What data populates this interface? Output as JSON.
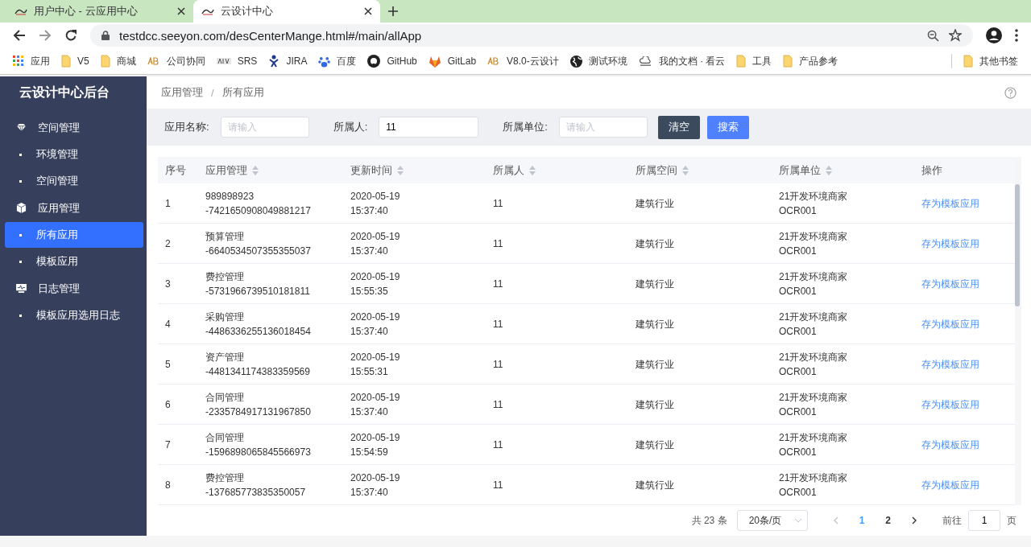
{
  "browser": {
    "tabs": [
      {
        "title": "用户中心 - 云应用中心",
        "selected": false
      },
      {
        "title": "云设计中心",
        "selected": true
      }
    ],
    "url": "testdcc.seeyon.com/desCenterMange.html#/main/allApp",
    "bookmarks": [
      {
        "label": "应用",
        "kind": "apps"
      },
      {
        "label": "V5",
        "kind": "folder"
      },
      {
        "label": "商城",
        "kind": "folder"
      },
      {
        "label": "公司协同",
        "kind": "ab"
      },
      {
        "label": "SRS",
        "kind": "abvs"
      },
      {
        "label": "JIRA",
        "kind": "jira"
      },
      {
        "label": "百度",
        "kind": "paw"
      },
      {
        "label": "GitHub",
        "kind": "github"
      },
      {
        "label": "GitLab",
        "kind": "gitlab"
      },
      {
        "label": "V8.0-云设计",
        "kind": "ab"
      },
      {
        "label": "测试环境",
        "kind": "globe"
      },
      {
        "label": "我的文档 · 看云",
        "kind": "cloud"
      },
      {
        "label": "工具",
        "kind": "folder"
      },
      {
        "label": "产品参考",
        "kind": "folder"
      }
    ],
    "other_bookmarks": "其他书签"
  },
  "sidebar": {
    "title": "云设计中心后台",
    "groups": [
      {
        "label": "空间管理",
        "children": [
          {
            "label": "环境管理",
            "selected": false
          },
          {
            "label": "空间管理",
            "selected": false
          }
        ]
      },
      {
        "label": "应用管理",
        "children": [
          {
            "label": "所有应用",
            "selected": true
          },
          {
            "label": "模板应用",
            "selected": false
          }
        ]
      },
      {
        "label": "日志管理",
        "children": [
          {
            "label": "模板应用选用日志",
            "selected": false
          }
        ]
      }
    ]
  },
  "breadcrumb": [
    "应用管理",
    "所有应用"
  ],
  "breadcrumb_separator": "/",
  "filters": [
    {
      "label": "应用名称:",
      "placeholder": "请输入"
    },
    {
      "label": "所属人:",
      "value": "11"
    },
    {
      "label": "所属单位:",
      "placeholder": "请输入"
    }
  ],
  "buttons": [
    {
      "label": "清空",
      "kind": "secondary"
    },
    {
      "label": "搜索",
      "kind": "primary"
    }
  ],
  "table": {
    "columns": [
      {
        "label": "序号",
        "sortable": false
      },
      {
        "label": "应用管理",
        "sortable": true
      },
      {
        "label": "更新时间",
        "sortable": true
      },
      {
        "label": "所属人",
        "sortable": true
      },
      {
        "label": "所属空间",
        "sortable": true
      },
      {
        "label": "所属单位",
        "sortable": true
      },
      {
        "label": "操作",
        "sortable": false
      }
    ],
    "rows": [
      {
        "index": "1",
        "app": [
          "989898923",
          "-7421650908049881217"
        ],
        "updated": [
          "2020-05-19",
          "15:37:40"
        ],
        "owner": "11",
        "space": "建筑行业",
        "unit": [
          "21开发环境商家",
          "OCR001"
        ],
        "action": "存为模板应用"
      },
      {
        "index": "2",
        "app": [
          "预算管理",
          "-6640534507355355037"
        ],
        "updated": [
          "2020-05-19",
          "15:37:40"
        ],
        "owner": "11",
        "space": "建筑行业",
        "unit": [
          "21开发环境商家",
          "OCR001"
        ],
        "action": "存为模板应用"
      },
      {
        "index": "3",
        "app": [
          "费控管理",
          "-5731966739510181811"
        ],
        "updated": [
          "2020-05-19",
          "15:55:35"
        ],
        "owner": "11",
        "space": "建筑行业",
        "unit": [
          "21开发环境商家",
          "OCR001"
        ],
        "action": "存为模板应用"
      },
      {
        "index": "4",
        "app": [
          "采购管理",
          "-4486336255136018454"
        ],
        "updated": [
          "2020-05-19",
          "15:37:40"
        ],
        "owner": "11",
        "space": "建筑行业",
        "unit": [
          "21开发环境商家",
          "OCR001"
        ],
        "action": "存为模板应用"
      },
      {
        "index": "5",
        "app": [
          "资产管理",
          "-4481341174383359569"
        ],
        "updated": [
          "2020-05-19",
          "15:55:31"
        ],
        "owner": "11",
        "space": "建筑行业",
        "unit": [
          "21开发环境商家",
          "OCR001"
        ],
        "action": "存为模板应用"
      },
      {
        "index": "6",
        "app": [
          "合同管理",
          "-2335784917131967850"
        ],
        "updated": [
          "2020-05-19",
          "15:37:40"
        ],
        "owner": "11",
        "space": "建筑行业",
        "unit": [
          "21开发环境商家",
          "OCR001"
        ],
        "action": "存为模板应用"
      },
      {
        "index": "7",
        "app": [
          "合同管理",
          "-1596898065845566973"
        ],
        "updated": [
          "2020-05-19",
          "15:54:59"
        ],
        "owner": "11",
        "space": "建筑行业",
        "unit": [
          "21开发环境商家",
          "OCR001"
        ],
        "action": "存为模板应用"
      },
      {
        "index": "8",
        "app": [
          "费控管理",
          "-137685773835350057"
        ],
        "updated": [
          "2020-05-19",
          "15:37:40"
        ],
        "owner": "11",
        "space": "建筑行业",
        "unit": [
          "21开发环境商家",
          "OCR001"
        ],
        "action": "存为模板应用"
      }
    ]
  },
  "pagination": {
    "total": "共 23 条",
    "page_size": "20条/页",
    "pages": [
      {
        "label": "1",
        "selected": true
      },
      {
        "label": "2",
        "selected": false
      }
    ],
    "goto_label": "前往",
    "goto_value": "1",
    "goto_suffix": "页"
  }
}
